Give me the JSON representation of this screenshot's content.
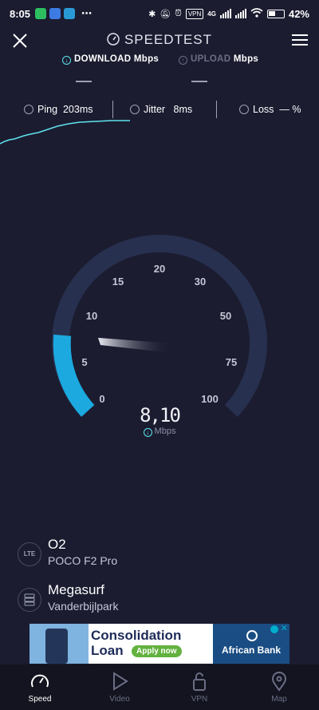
{
  "status_bar": {
    "time": "8:05",
    "dots": "⋯",
    "vpn": "VPN",
    "network": "4G",
    "battery": "42%"
  },
  "header": {
    "title": "SPEEDTEST"
  },
  "metrics": {
    "download_label": "DOWNLOAD",
    "download_unit": "Mbps",
    "download_value": "—",
    "upload_label": "UPLOAD",
    "upload_unit": "Mbps",
    "upload_value": "—"
  },
  "stats": {
    "ping_label": "Ping",
    "ping_value": "203ms",
    "jitter_label": "Jitter",
    "jitter_value": "8ms",
    "loss_label": "Loss",
    "loss_value": "— %"
  },
  "gauge": {
    "ticks": [
      "0",
      "5",
      "10",
      "15",
      "20",
      "30",
      "50",
      "75",
      "100"
    ],
    "reading": "8,10",
    "unit": "Mbps",
    "needle_value": 8.1,
    "accent_color": "#1ba9e0",
    "track_color": "#2a3452"
  },
  "provider": {
    "icon_label": "LTE",
    "name": "O2",
    "device": "POCO F2 Pro"
  },
  "server": {
    "name": "Megasurf",
    "location": "Vanderbijlpark"
  },
  "ad": {
    "title_line1": "Consolidation",
    "title_line2": "Loan",
    "apply": "Apply now",
    "brand": "African Bank"
  },
  "nav": {
    "items": [
      {
        "label": "Speed",
        "icon": "speedometer-icon",
        "active": true
      },
      {
        "label": "Video",
        "icon": "play-icon",
        "active": false
      },
      {
        "label": "VPN",
        "icon": "lock-icon",
        "active": false
      },
      {
        "label": "Map",
        "icon": "map-pin-icon",
        "active": false
      }
    ]
  }
}
